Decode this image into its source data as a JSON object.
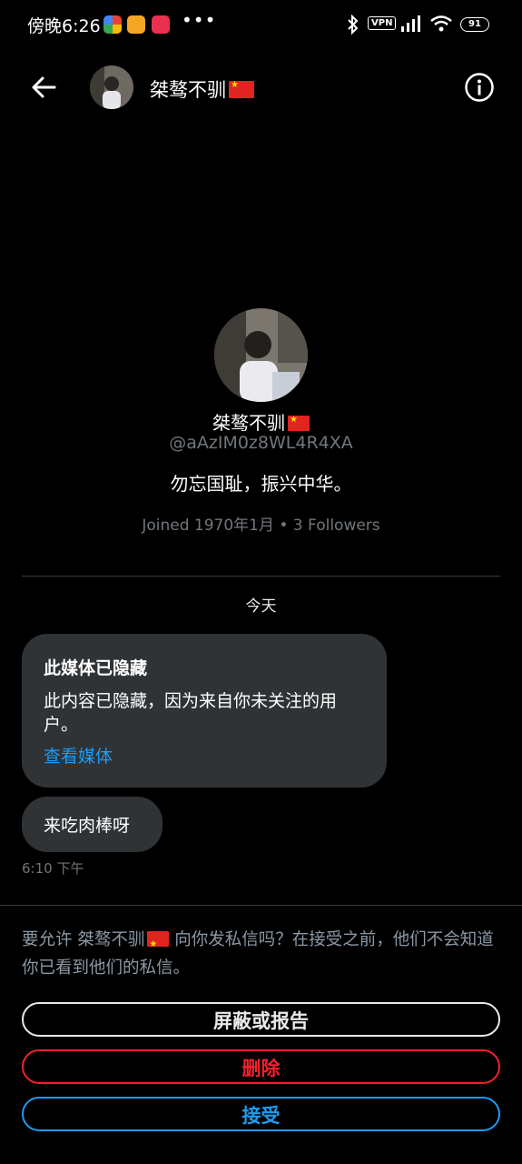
{
  "status_bar": {
    "time": "傍晚6:26",
    "dots": "•••",
    "vpn": "VPN",
    "battery": "91"
  },
  "header": {
    "name": "桀骜不驯"
  },
  "profile": {
    "name": "桀骜不驯",
    "handle": "@aAzIM0z8WL4R4XA",
    "bio": "勿忘国耻，振兴中华。",
    "meta": "Joined 1970年1月 • 3 Followers"
  },
  "conversation": {
    "day_label": "今天",
    "media_hidden": {
      "title": "此媒体已隐藏",
      "text": "此内容已隐藏，因为来自你未关注的用户。",
      "link": "查看媒体"
    },
    "message": {
      "text": "来吃肉棒呀",
      "time": "6:10 下午"
    }
  },
  "request": {
    "prompt_pre": "要允许 桀骜不驯",
    "prompt_post": " 向你发私信吗？在接受之前，他们不会知道你已看到他们的私信。",
    "block_label": "屏蔽或报告",
    "delete_label": "删除",
    "accept_label": "接受"
  },
  "colors": {
    "accent": "#1d9bf0",
    "danger": "#f4212e",
    "bubble": "#2f3336"
  }
}
